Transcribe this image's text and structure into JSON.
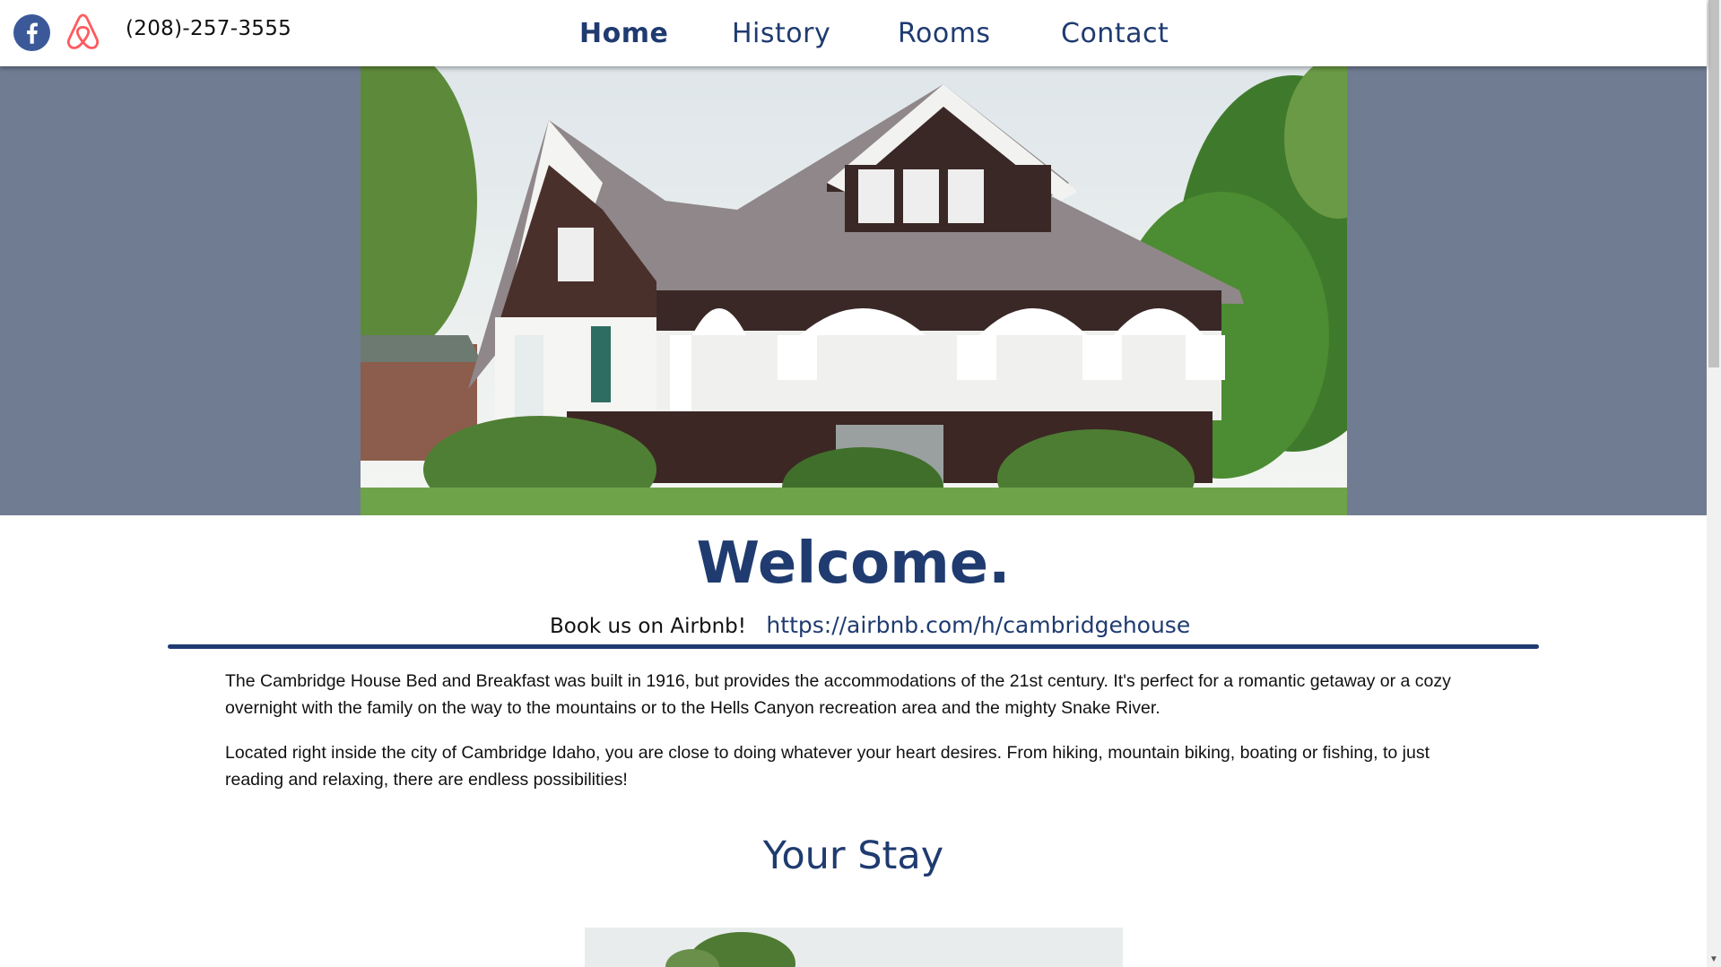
{
  "header": {
    "phone": "(208)-257-3555",
    "social_icons": [
      "facebook-icon",
      "airbnb-icon"
    ],
    "nav": [
      {
        "label": "Home",
        "active": true
      },
      {
        "label": "History",
        "active": false
      },
      {
        "label": "Rooms",
        "active": false
      },
      {
        "label": "Contact",
        "active": false
      }
    ]
  },
  "main": {
    "welcome": "Welcome.",
    "book_label": "Book us on Airbnb!",
    "book_link": "https://airbnb.com/h/cambridgehouse",
    "paragraphs": [
      "The Cambridge House Bed and Breakfast was built in 1916, but provides the accommodations of the 21st century. It's perfect for a romantic getaway or a cozy overnight with the family on the way to the mountains or to the Hells Canyon recreation area and the mighty Snake River.",
      "Located right inside the city of Cambridge Idaho, you are close to doing whatever your heart desires. From hiking, mountain biking, boating or fishing, to just reading and relaxing, there are endless possibilities!"
    ],
    "your_stay": "Your Stay"
  },
  "colors": {
    "brand_navy": "#1f3b70",
    "hero_background": "#707c92",
    "facebook_blue": "#3b5998",
    "airbnb_red": "#ff5a5f"
  }
}
